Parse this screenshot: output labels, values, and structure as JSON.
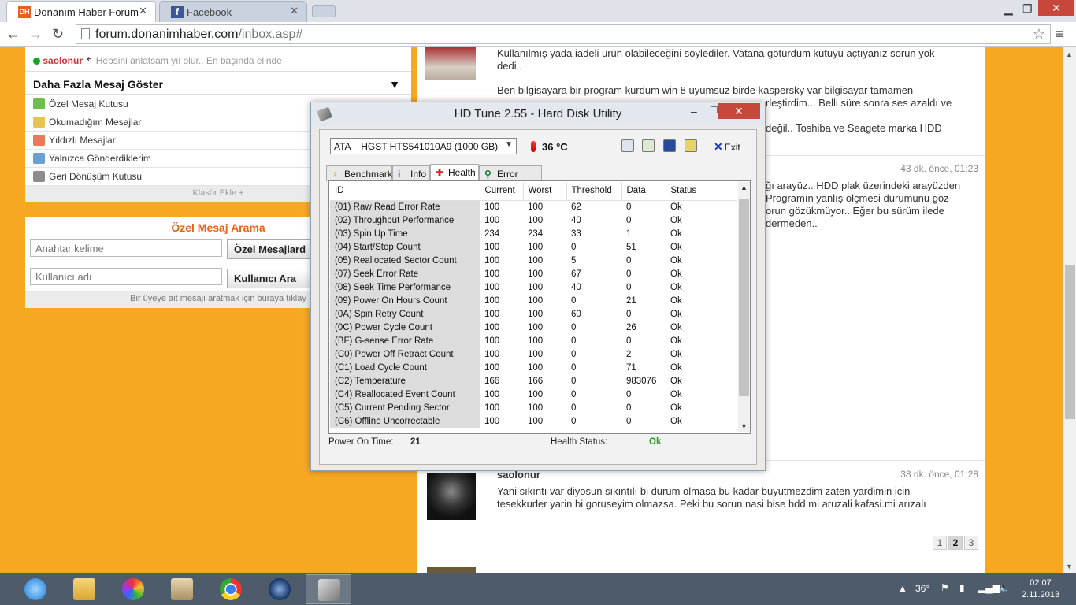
{
  "browser": {
    "tabs": [
      {
        "label": "Donanım Haber Forum",
        "favicon": "DH"
      },
      {
        "label": "Facebook",
        "favicon": "f"
      }
    ],
    "url_host": "forum.donanimhaber.com",
    "url_path": "/inbox.asp#",
    "accent": "#f7a823"
  },
  "sidebar": {
    "prev_user": "saolonur",
    "prev_snippet": "Hepsini anlatsam yıl olur.. En başında elinde",
    "more_messages": "Daha Fazla Mesaj Göster",
    "folders": [
      {
        "label": "Özel Mesaj Kutusu",
        "icon": "inbox-download-icon"
      },
      {
        "label": "Okumadığım Mesajlar",
        "icon": "unread-folder-icon"
      },
      {
        "label": "Yıldızlı Mesajlar",
        "icon": "starred-folder-icon"
      },
      {
        "label": "Yalnızca Gönderdiklerim",
        "icon": "sent-icon"
      },
      {
        "label": "Geri Dönüşüm Kutusu",
        "icon": "recycle-bin-icon"
      }
    ],
    "add_folder": "Klasör Ekle +"
  },
  "search": {
    "title": "Özel Mesaj Arama",
    "keyword_placeholder": "Anahtar kelime",
    "keyword_button": "Özel Mesajlard",
    "user_placeholder": "Kullanıcı adı",
    "user_button": "Kullanıcı Ara",
    "hint": "Bir üyeye ait mesajı aratmak için buraya tıklay"
  },
  "posts": {
    "p1_line1": "Kullanılmış yada iadeli ürün olabileceğini söylediler. Vatana götürdüm kutuyu açtıyanız sorun yok",
    "p1_line2": "dedi..",
    "p1_line3": "Ben bilgisayara bir program kurdum win 8 uyumsuz birde kaspersky var bilgisayar tamamen",
    "p1_line4_r": "rleştirdim... Belli süre sonra ses azaldı ve",
    "p1_line5_r": "değil.. Toshiba ve Seagete marka HDD",
    "p2_time": "43 dk. önce, 01:23",
    "p2_line1_r": "ğı arayüz.. HDD plak üzerindeki arayüzden",
    "p2_line2_r": "Programın yanlış ölçmesi durumunu göz",
    "p2_line3_r": "orun gözükmüyor.. Eğer bu sürüm ilede",
    "p2_line4_r": "dermeden..",
    "p3_user": "saolonur",
    "p3_time": "38 dk. önce, 01:28",
    "p3_line1": "Yani sıkıntı var diyosun sıkıntılı bi durum olmasa bu kadar buyutmezdim zaten yardimin icin",
    "p3_line2": "tesekkurler yarin bi goruseyim olmazsa. Peki bu sorun nasi bise hdd mi aruzali kafasi.mi arızalı",
    "pages": [
      "1",
      "2",
      "3"
    ]
  },
  "hdtune": {
    "title": "HD Tune 2.55 - Hard Disk Utility",
    "drive": "ATA    HGST HTS541010A9 (1000 GB)",
    "temperature": "36 °C",
    "exit": "Exit",
    "tabs": [
      "Benchmark",
      "Info",
      "Health",
      "Error Scan"
    ],
    "columns": [
      "ID",
      "Current",
      "Worst",
      "Threshold",
      "Data",
      "Status"
    ],
    "rows": [
      [
        "(01) Raw Read Error Rate",
        "100",
        "100",
        "62",
        "0",
        "Ok"
      ],
      [
        "(02) Throughput Performance",
        "100",
        "100",
        "40",
        "0",
        "Ok"
      ],
      [
        "(03) Spin Up Time",
        "234",
        "234",
        "33",
        "1",
        "Ok"
      ],
      [
        "(04) Start/Stop Count",
        "100",
        "100",
        "0",
        "51",
        "Ok"
      ],
      [
        "(05) Reallocated Sector Count",
        "100",
        "100",
        "5",
        "0",
        "Ok"
      ],
      [
        "(07) Seek Error Rate",
        "100",
        "100",
        "67",
        "0",
        "Ok"
      ],
      [
        "(08) Seek Time Performance",
        "100",
        "100",
        "40",
        "0",
        "Ok"
      ],
      [
        "(09) Power On Hours Count",
        "100",
        "100",
        "0",
        "21",
        "Ok"
      ],
      [
        "(0A) Spin Retry Count",
        "100",
        "100",
        "60",
        "0",
        "Ok"
      ],
      [
        "(0C) Power Cycle Count",
        "100",
        "100",
        "0",
        "26",
        "Ok"
      ],
      [
        "(BF) G-sense Error Rate",
        "100",
        "100",
        "0",
        "0",
        "Ok"
      ],
      [
        "(C0) Power Off Retract Count",
        "100",
        "100",
        "0",
        "2",
        "Ok"
      ],
      [
        "(C1) Load Cycle Count",
        "100",
        "100",
        "0",
        "71",
        "Ok"
      ],
      [
        "(C2) Temperature",
        "166",
        "166",
        "0",
        "983076",
        "Ok"
      ],
      [
        "(C4) Reallocated Event Count",
        "100",
        "100",
        "0",
        "0",
        "Ok"
      ],
      [
        "(C5) Current Pending Sector",
        "100",
        "100",
        "0",
        "0",
        "Ok"
      ],
      [
        "(C6) Offline Uncorrectable",
        "100",
        "100",
        "0",
        "0",
        "Ok"
      ]
    ],
    "power_on_label": "Power On Time:",
    "power_on_value": "21",
    "health_label": "Health Status:",
    "health_value": "Ok",
    "health_color": "#1aa31a"
  },
  "taskbar": {
    "apps": [
      "internet-explorer-icon",
      "file-explorer-icon",
      "picasa-icon",
      "game-icon",
      "chrome-icon",
      "media-icon",
      "hdtune-icon"
    ],
    "temp": "36°",
    "time": "02:07",
    "date": "2.11.2013"
  }
}
